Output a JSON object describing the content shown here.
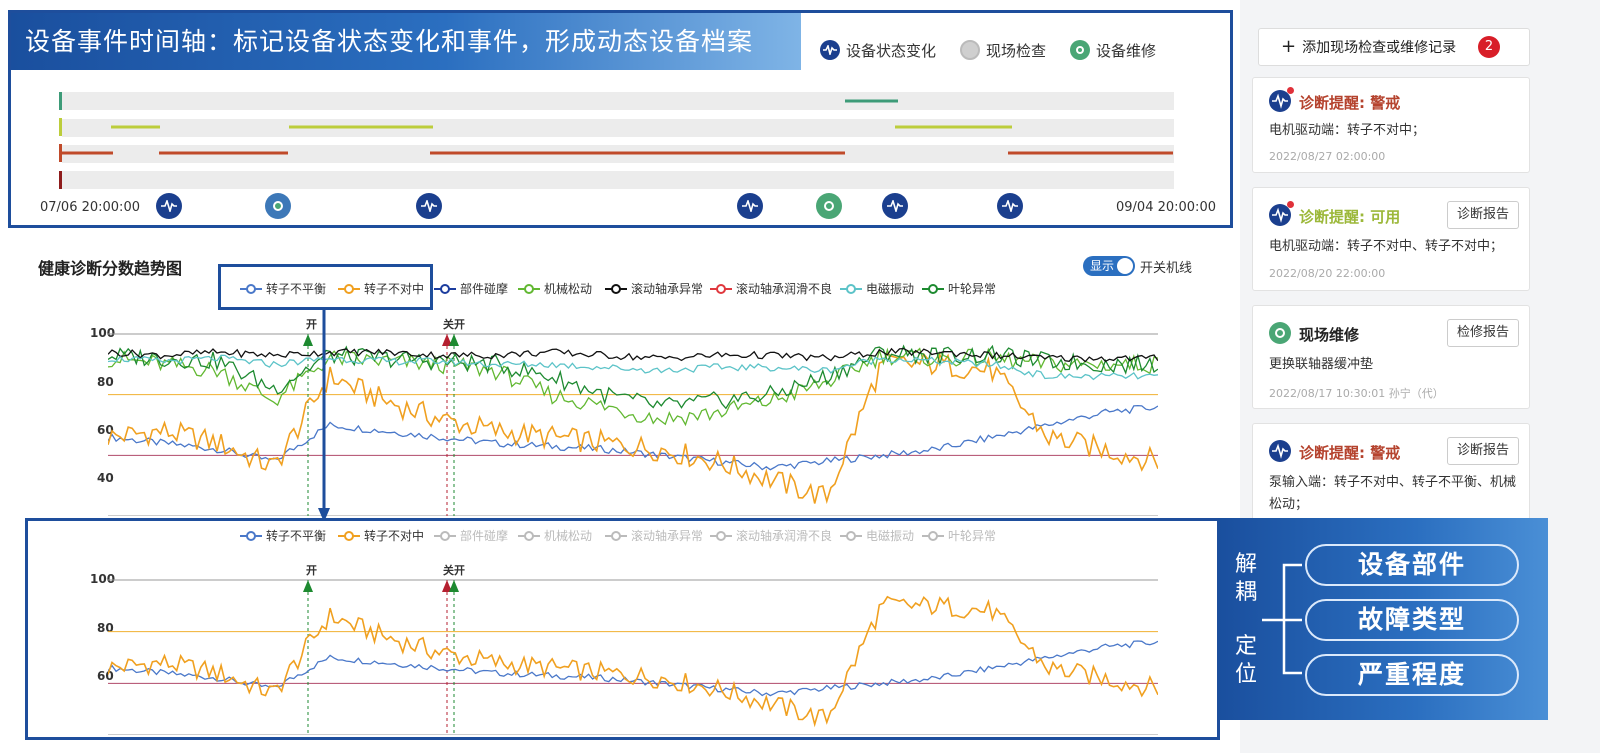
{
  "timeline": {
    "banner": "设备事件时间轴：标记设备状态变化和事件，形成动态设备档案",
    "legend": [
      {
        "label": "设备状态变化",
        "icon": "pulse-icon"
      },
      {
        "label": "现场检查",
        "icon": "eye-icon"
      },
      {
        "label": "设备维修",
        "icon": "wrench-icon"
      }
    ],
    "start_date": "07/06 20:00:00",
    "end_date": "09/04 20:00:00"
  },
  "health_chart": {
    "title": "健康诊断分数趋势图",
    "toggle_label": "显示",
    "toggle_caption": "开关机线",
    "legend": [
      {
        "label": "转子不平衡",
        "color": "#4a78c9"
      },
      {
        "label": "转子不对中",
        "color": "#f0a020"
      },
      {
        "label": "部件碰摩",
        "color": "#1c3d9e"
      },
      {
        "label": "机械松动",
        "color": "#62b832"
      },
      {
        "label": "滚动轴承异常",
        "color": "#111111"
      },
      {
        "label": "滚动轴承润滑不良",
        "color": "#e0383e"
      },
      {
        "label": "电磁振动",
        "color": "#5cc3c8"
      },
      {
        "label": "叶轮异常",
        "color": "#1d8a30"
      }
    ],
    "markers": [
      "开",
      "关开"
    ]
  },
  "chart_data": [
    {
      "type": "line",
      "title": "健康诊断分数趋势图",
      "ylim": [
        40,
        100
      ],
      "yticks": [
        100,
        80,
        60,
        40
      ],
      "series": [
        {
          "name": "转子不平衡",
          "values": [
            66,
            64,
            62,
            58,
            70,
            68,
            66,
            64,
            63,
            62,
            60,
            58,
            56,
            58,
            60,
            62,
            66,
            70,
            74,
            76
          ]
        },
        {
          "name": "转子不对中",
          "values": [
            66,
            68,
            64,
            56,
            86,
            78,
            72,
            68,
            66,
            64,
            62,
            58,
            52,
            46,
            90,
            90,
            88,
            66,
            62,
            58
          ]
        },
        {
          "name": "机械松动",
          "values": [
            92,
            90,
            88,
            78,
            92,
            91,
            90,
            88,
            80,
            76,
            72,
            74,
            78,
            84,
            93,
            92,
            92,
            90,
            90,
            90
          ]
        },
        {
          "name": "叶轮异常",
          "values": [
            93,
            92,
            91,
            82,
            93,
            92,
            91,
            90,
            86,
            80,
            76,
            78,
            80,
            86,
            94,
            93,
            93,
            91,
            90,
            90
          ]
        },
        {
          "name": "滚动轴承异常",
          "values": [
            94,
            93,
            94,
            93,
            94,
            94,
            93,
            93,
            94,
            93,
            92,
            93,
            93,
            92,
            94,
            94,
            93,
            92,
            92,
            92
          ]
        },
        {
          "name": "电磁振动",
          "values": [
            92,
            91,
            92,
            90,
            92,
            91,
            91,
            90,
            90,
            89,
            88,
            89,
            89,
            88,
            92,
            91,
            90,
            86,
            86,
            86
          ]
        }
      ]
    },
    {
      "type": "line",
      "ylim": [
        40,
        100
      ],
      "yticks": [
        100,
        80,
        60,
        40
      ],
      "series": [
        {
          "name": "转子不平衡",
          "values": [
            66,
            64,
            62,
            58,
            70,
            68,
            66,
            64,
            63,
            62,
            60,
            58,
            56,
            58,
            60,
            62,
            66,
            70,
            74,
            76
          ]
        },
        {
          "name": "转子不对中",
          "values": [
            66,
            68,
            64,
            56,
            86,
            78,
            72,
            68,
            66,
            64,
            62,
            58,
            52,
            46,
            90,
            90,
            88,
            66,
            62,
            58
          ]
        }
      ]
    }
  ],
  "sidebar": {
    "add_button": "添加现场检查或维修记录",
    "add_badge": "2",
    "cards": [
      {
        "title": "诊断提醒: 警戒",
        "desc": "电机驱动端：转子不对中；",
        "time": "2022/08/27 02:00:00",
        "button": ""
      },
      {
        "title": "诊断提醒: 可用",
        "desc": "电机驱动端：转子不对中、转子不对中；",
        "time": "2022/08/20 22:00:00",
        "button": "诊断报告"
      },
      {
        "title": "现场维修",
        "desc": "更换联轴器缓冲垫",
        "time": "2022/08/17 10:30:01 孙宁（代）",
        "button": "检修报告"
      },
      {
        "title": "诊断提醒: 警戒",
        "desc": "泵输入端：转子不对中、转子不平衡、机械松动；",
        "time": "",
        "button": "诊断报告"
      }
    ]
  },
  "decouple": {
    "left_top": [
      "解",
      "耦"
    ],
    "left_bottom": [
      "定",
      "位"
    ],
    "pills": [
      "设备部件",
      "故障类型",
      "严重程度"
    ]
  }
}
